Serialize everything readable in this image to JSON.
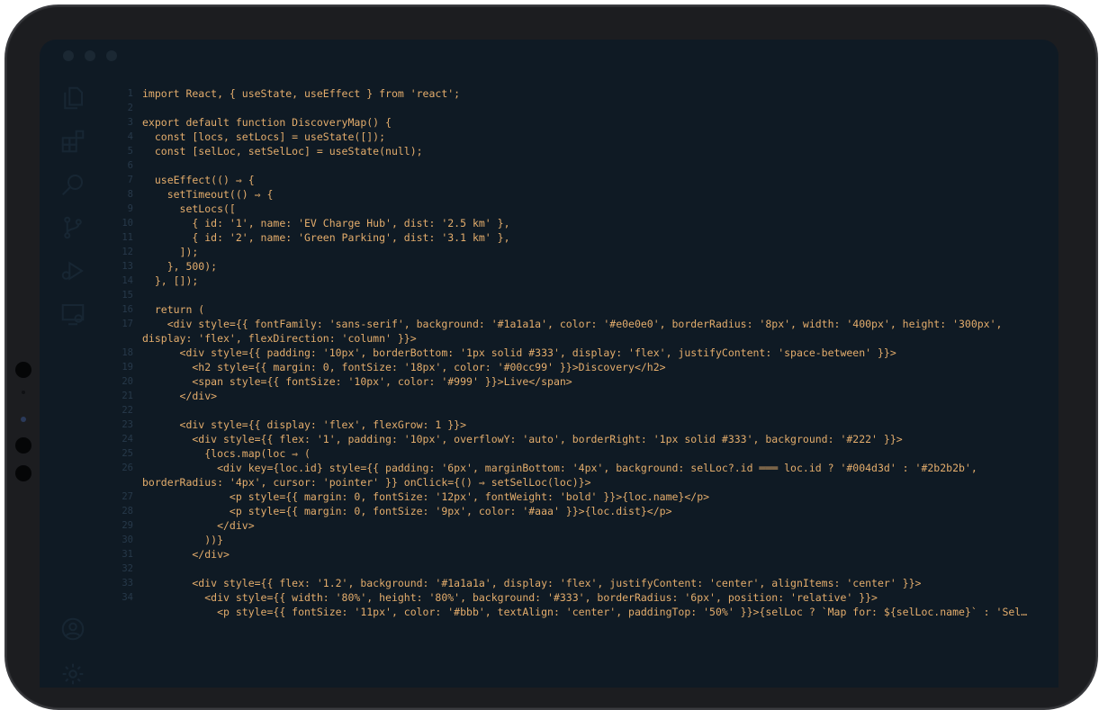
{
  "theme": {
    "screen_bg": "#0f1a24",
    "code_color": "#e4ad6c",
    "linenum_color": "#27394a",
    "icon_color": "#1f3140"
  },
  "activity_icons": [
    "files-icon",
    "extensions-icon",
    "search-icon",
    "source-control-icon",
    "run-debug-icon",
    "remote-explorer-icon",
    "account-icon",
    "settings-icon"
  ],
  "editor": {
    "lines": [
      {
        "n": "1",
        "text": "import React, { useState, useEffect } from 'react';"
      },
      {
        "n": "2",
        "text": ""
      },
      {
        "n": "3",
        "text": "export default function DiscoveryMap() {"
      },
      {
        "n": "4",
        "text": "  const [locs, setLocs] = useState([]);"
      },
      {
        "n": "5",
        "text": "  const [selLoc, setSelLoc] = useState(null);"
      },
      {
        "n": "6",
        "text": ""
      },
      {
        "n": "7",
        "text": "  useEffect(() ⇒ {"
      },
      {
        "n": "8",
        "text": "    setTimeout(() ⇒ {"
      },
      {
        "n": "9",
        "text": "      setLocs(["
      },
      {
        "n": "10",
        "text": "        { id: '1', name: 'EV Charge Hub', dist: '2.5 km' },"
      },
      {
        "n": "11",
        "text": "        { id: '2', name: 'Green Parking', dist: '3.1 km' },"
      },
      {
        "n": "12",
        "text": "      ]);"
      },
      {
        "n": "13",
        "text": "    }, 500);"
      },
      {
        "n": "14",
        "text": "  }, []);"
      },
      {
        "n": "15",
        "text": ""
      },
      {
        "n": "16",
        "text": "  return ("
      },
      {
        "n": "17",
        "text": "    <div style={{ fontFamily: 'sans-serif', background: '#1a1a1a', color: '#e0e0e0', borderRadius: '8px', width: '400px', height: '300px',"
      },
      {
        "n": "",
        "text": "display: 'flex', flexDirection: 'column' }}>"
      },
      {
        "n": "18",
        "text": "      <div style={{ padding: '10px', borderBottom: '1px solid #333', display: 'flex', justifyContent: 'space-between' }}>"
      },
      {
        "n": "19",
        "text": "        <h2 style={{ margin: 0, fontSize: '18px', color: '#00cc99' }}>Discovery</h2>"
      },
      {
        "n": "20",
        "text": "        <span style={{ fontSize: '10px', color: '#999' }}>Live</span>"
      },
      {
        "n": "21",
        "text": "      </div>"
      },
      {
        "n": "22",
        "text": ""
      },
      {
        "n": "23",
        "text": "      <div style={{ display: 'flex', flexGrow: 1 }}>"
      },
      {
        "n": "24",
        "text": "        <div style={{ flex: '1', padding: '10px', overflowY: 'auto', borderRight: '1px solid #333', background: '#222' }}>"
      },
      {
        "n": "25",
        "text": "          {locs.map(loc ⇒ ("
      },
      {
        "n": "26",
        "text": "            <div key={loc.id} style={{ padding: '6px', marginBottom: '4px', background: selLoc?.id ═══ loc.id ? '#004d3d' : '#2b2b2b',"
      },
      {
        "n": "",
        "text": "borderRadius: '4px', cursor: 'pointer' }} onClick={() ⇒ setSelLoc(loc)}>"
      },
      {
        "n": "27",
        "text": "              <p style={{ margin: 0, fontSize: '12px', fontWeight: 'bold' }}>{loc.name}</p>"
      },
      {
        "n": "28",
        "text": "              <p style={{ margin: 0, fontSize: '9px', color: '#aaa' }}>{loc.dist}</p>"
      },
      {
        "n": "29",
        "text": "            </div>"
      },
      {
        "n": "30",
        "text": "          ))}"
      },
      {
        "n": "31",
        "text": "        </div>"
      },
      {
        "n": "32",
        "text": ""
      },
      {
        "n": "33",
        "text": "        <div style={{ flex: '1.2', background: '#1a1a1a', display: 'flex', justifyContent: 'center', alignItems: 'center' }}>"
      },
      {
        "n": "34",
        "text": "          <div style={{ width: '80%', height: '80%', background: '#333', borderRadius: '6px', position: 'relative' }}>"
      },
      {
        "n": "",
        "text": "            <p style={{ fontSize: '11px', color: '#bbb', textAlign: 'center', paddingTop: '50%' }}>{selLoc ? `Map for: ${selLoc.name}` : 'Sel…"
      }
    ]
  }
}
